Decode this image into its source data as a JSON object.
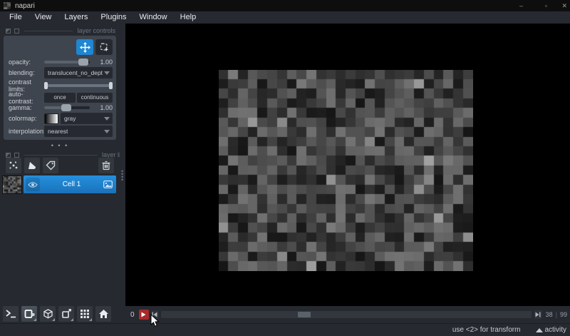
{
  "window": {
    "title": "napari",
    "minimize": "–",
    "maximize": "▫",
    "close": "✕"
  },
  "menubar": {
    "items": [
      "File",
      "View",
      "Layers",
      "Plugins",
      "Window",
      "Help"
    ]
  },
  "layer_controls": {
    "dock_title": "layer controls",
    "rows": {
      "opacity": {
        "label": "opacity:",
        "value": "1.00",
        "percent": 95
      },
      "blending": {
        "label": "blending:",
        "value": "translucent_no_depth"
      },
      "contrast_limits": {
        "label": "contrast limits:",
        "low_percent": 0,
        "high_percent": 100
      },
      "auto_contrast": {
        "label": "auto-contrast:",
        "once": "once",
        "continuous": "continuous"
      },
      "gamma": {
        "label": "gamma:",
        "value": "1.00",
        "percent": 47
      },
      "colormap": {
        "label": "colormap:",
        "value": "gray"
      },
      "interpolation": {
        "label": "interpolation:",
        "value": "nearest"
      }
    },
    "expander": "• • •"
  },
  "layer_list": {
    "dock_title": "layer list",
    "layers": [
      {
        "name": "Cell 1",
        "visible": true,
        "selected": true,
        "type": "image"
      }
    ]
  },
  "dims_slider": {
    "axis_label": "0",
    "current": 38,
    "total": 99
  },
  "status_bar": {
    "hint": "use <2> for transform",
    "activity": "activity"
  },
  "canvas_image": {
    "cols": 26,
    "rows": 21,
    "seed": 12,
    "thumb_seed": 5,
    "icon_seed": 3
  },
  "colors": {
    "highlight": "#1f86d2",
    "panel": "#3f454e",
    "background": "#262930",
    "canvas": "#000000",
    "play_button": "#a82a2a"
  }
}
